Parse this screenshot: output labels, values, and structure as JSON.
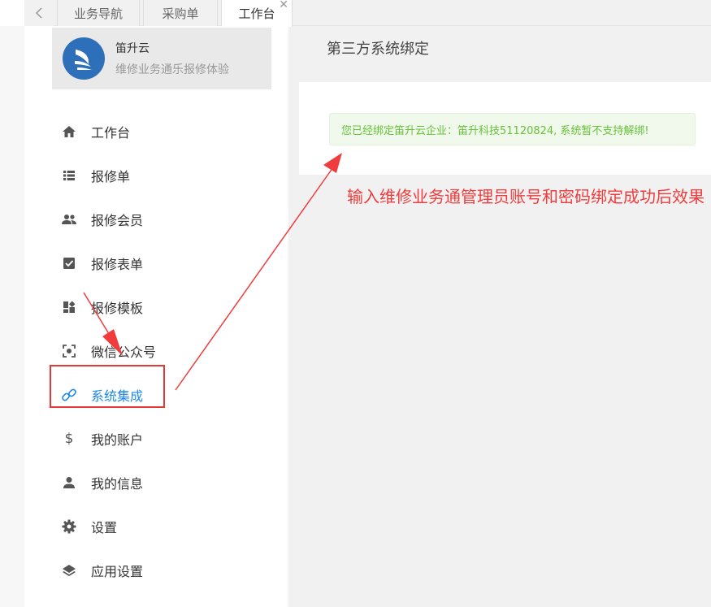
{
  "tabs": [
    {
      "label": "业务导航"
    },
    {
      "label": "采购单"
    },
    {
      "label": "工作台"
    }
  ],
  "brand": {
    "name": "笛升云",
    "subtitle": "维修业务通乐报修体验"
  },
  "menu": [
    {
      "label": "工作台",
      "icon": "home-icon"
    },
    {
      "label": "报修单",
      "icon": "list-icon"
    },
    {
      "label": "报修会员",
      "icon": "people-icon"
    },
    {
      "label": "报修表单",
      "icon": "checkbox-icon"
    },
    {
      "label": "报修模板",
      "icon": "dashboard-icon"
    },
    {
      "label": "微信公众号",
      "icon": "scan-icon"
    },
    {
      "label": "系统集成",
      "icon": "link-icon",
      "active": true
    },
    {
      "label": "我的账户",
      "icon": "dollar-icon"
    },
    {
      "label": "我的信息",
      "icon": "person-icon"
    },
    {
      "label": "设置",
      "icon": "gear-icon"
    },
    {
      "label": "应用设置",
      "icon": "layers-icon"
    }
  ],
  "main": {
    "title": "第三方系统绑定",
    "alert": "您已经绑定笛升云企业：笛升科技51120824, 系统暂不支持解绑!"
  },
  "annotation": {
    "text": "输入维修业务通管理员账号和密码绑定成功后效果"
  },
  "colors": {
    "accent": "#1e88e5",
    "annotation": "#f03c3c",
    "success_text": "#67c23a",
    "success_bg": "#f0f9eb"
  }
}
